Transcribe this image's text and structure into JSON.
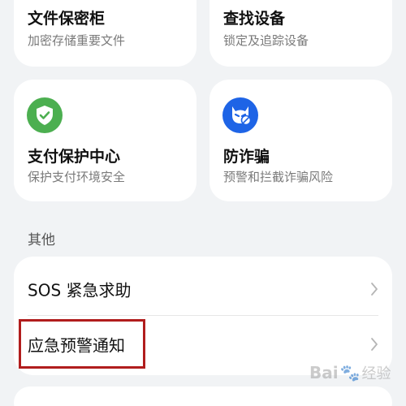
{
  "cards": {
    "file_safe": {
      "title": "文件保密柜",
      "subtitle": "加密存储重要文件"
    },
    "find_device": {
      "title": "查找设备",
      "subtitle": "锁定及追踪设备"
    },
    "payment_protection": {
      "title": "支付保护中心",
      "subtitle": "保护支付环境安全",
      "icon": "shield-check-icon",
      "icon_color": "#4caf50"
    },
    "anti_fraud": {
      "title": "防诈骗",
      "subtitle": "预警和拦截诈骗风险",
      "icon": "devil-mask-icon",
      "icon_color": "#1e64e6"
    }
  },
  "other_section": {
    "label": "其他",
    "items": [
      {
        "label": "SOS 紧急求助"
      },
      {
        "label": "应急预警通知"
      }
    ]
  },
  "colors": {
    "highlight": "#b11d1d",
    "background": "#f1f3f5"
  },
  "watermark": {
    "text": "Bai",
    "text2": "经验"
  }
}
